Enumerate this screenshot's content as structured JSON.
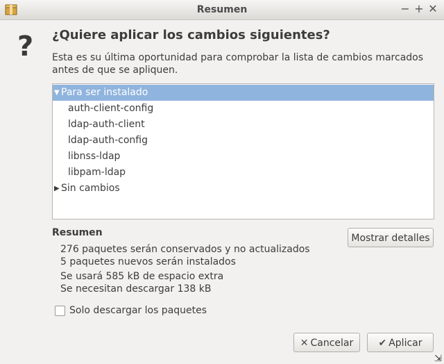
{
  "window": {
    "title": "Resumen",
    "controls": {
      "minimize": "−",
      "maximize": "+",
      "close": "✕"
    }
  },
  "dialog": {
    "icon": "?",
    "heading": "¿Quiere aplicar los cambios siguientes?",
    "description_line1": "Esta es su última oportunidad para comprobar la lista de cambios marcados",
    "description_line2": "antes de que se apliquen."
  },
  "tree": {
    "groups": [
      {
        "label": "Para ser instalado",
        "expanded": true,
        "selected": true,
        "items": [
          "auth-client-config",
          "ldap-auth-client",
          "ldap-auth-config",
          "libnss-ldap",
          "libpam-ldap"
        ]
      },
      {
        "label": "Sin cambios",
        "expanded": false,
        "selected": false,
        "items": []
      }
    ]
  },
  "summary": {
    "label": "Resumen",
    "line1": "276 paquetes serán conservados y no actualizados",
    "line2": "5 paquetes nuevos serán instalados",
    "line3": "Se usará 585 kB de espacio extra",
    "line4": "Se necesitan descargar 138 kB",
    "details_button": "Mostrar detalles"
  },
  "download_only": {
    "label": "Solo descargar los paquetes",
    "checked": false
  },
  "buttons": {
    "cancel": "Cancelar",
    "apply": "Aplicar"
  },
  "colors": {
    "selection": "#8fb4dd",
    "background": "#f2f1f0"
  }
}
